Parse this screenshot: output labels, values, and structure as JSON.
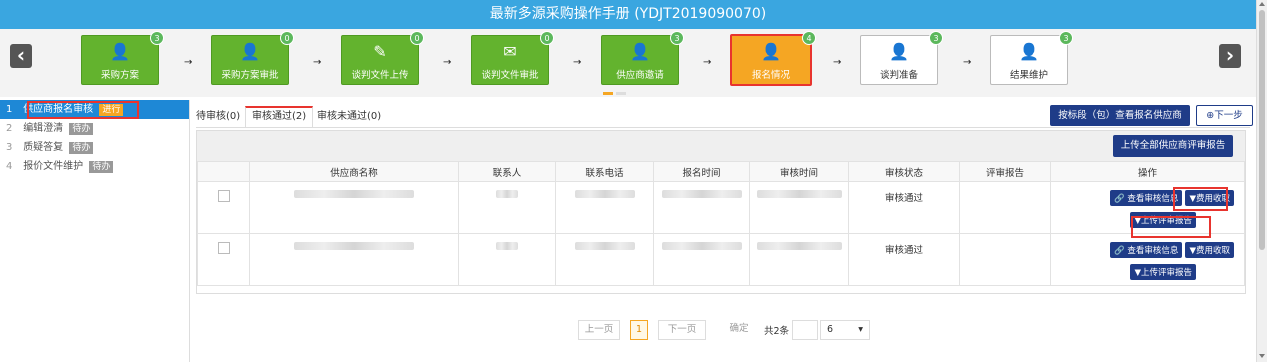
{
  "title": "最新多源采购操作手册 (YDJT2019090070)",
  "steps": [
    {
      "label": "采购方案",
      "badge": "3",
      "icon": "person-icon"
    },
    {
      "label": "采购方案审批",
      "badge": "0",
      "icon": "person-icon"
    },
    {
      "label": "谈判文件上传",
      "badge": "0",
      "icon": "pencil-icon"
    },
    {
      "label": "谈判文件审批",
      "badge": "0",
      "icon": "envelope-icon"
    },
    {
      "label": "供应商邀请",
      "badge": "3",
      "icon": "person-icon"
    },
    {
      "label": "报名情况",
      "badge": "4",
      "icon": "person-icon"
    },
    {
      "label": "谈判准备",
      "badge": "3",
      "icon": "person-icon"
    },
    {
      "label": "结果维护",
      "badge": "3",
      "icon": "person-icon"
    }
  ],
  "sidebar": [
    {
      "num": "1",
      "label": "供应商报名审核",
      "status": "进行"
    },
    {
      "num": "2",
      "label": "编辑澄清",
      "status": "待办"
    },
    {
      "num": "3",
      "label": "质疑答复",
      "status": "待办"
    },
    {
      "num": "4",
      "label": "报价文件维护",
      "status": "待办"
    }
  ],
  "tabs": {
    "pending": "待审核(0)",
    "passed": "审核通过(2)",
    "failed": "审核未通过(0)"
  },
  "buttons": {
    "view_by_lot": "按标段（包）查看报名供应商",
    "next_step": "⊕下一步",
    "upload_all": "上传全部供应商评审报告"
  },
  "table": {
    "headers": [
      "供应商名称",
      "联系人",
      "联系电话",
      "报名时间",
      "审核时间",
      "审核状态",
      "评审报告",
      "操作"
    ],
    "rows": [
      {
        "status": "审核通过"
      },
      {
        "status": "审核通过"
      }
    ],
    "op_view": "查看审核信息",
    "op_fee": "费用收取",
    "op_upload": "上传评审报告"
  },
  "pager": {
    "prev": "上一页",
    "current": "1",
    "next": "下一页",
    "confirm": "确定",
    "total": "共2条",
    "page_size": "6"
  }
}
